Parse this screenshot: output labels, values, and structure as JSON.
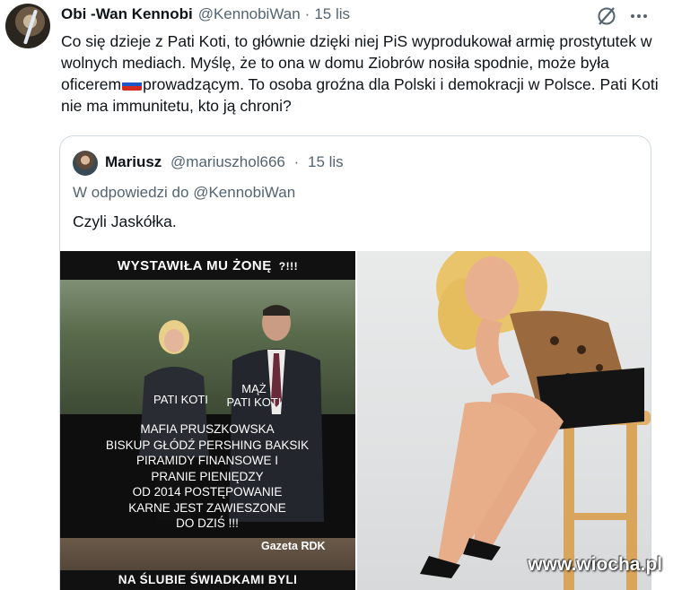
{
  "tweet": {
    "author_name": "Obi -Wan Kennobi",
    "author_handle": "@KennobiWan",
    "separator": "·",
    "time": "15 lis",
    "text_part1": "Co się dzieje z Pati Koti, to głównie dzięki niej PiS wyprodukował armię prostytutek w wolnych mediach. Myślę, że to ona w domu Ziobrów nosiła spodnie, może była oficerem",
    "text_part2": "prowadzącym. To osoba groźna dla Polski i demokracji w Polsce. Pati Koti nie ma immunitetu, kto ją chroni?",
    "flag_icon": "russia-flag-icon",
    "grok_icon": "grok-icon",
    "more_icon": "more-icon"
  },
  "quote": {
    "author_name": "Mariusz",
    "author_handle": "@mariuszhol666",
    "separator": "·",
    "time": "15 lis",
    "reply_prefix": "W odpowiedzi do",
    "reply_mention": "@KennobiWan",
    "text": "Czyli Jaskółka."
  },
  "meme": {
    "caption_top": "WYSTAWIŁA MU ŻONĘ",
    "caption_top_suffix": "?!!!",
    "label_woman": "PATI KOTI",
    "label_man_line1": "MĄŻ",
    "label_man_line2": "PATI KOTI",
    "box_lines": [
      "MAFIA PRUSZKOWSKA",
      "BISKUP GŁÓDŹ PERSHING BAKSIK",
      "PIRAMIDY FINANSOWE I",
      "PRANIE PIENIĘDZY",
      "OD 2014 POSTĘPOWANIE",
      "KARNE JEST ZAWIESZONE",
      "DO DZIŚ !!!"
    ],
    "source": "Gazeta RDK",
    "caption_bottom": "NA ŚLUBIE ŚWIADKAMI BYLI"
  },
  "watermark": "www.wiocha.pl",
  "colors": {
    "text_primary": "#0f1419",
    "text_secondary": "#536471",
    "border": "#cfd9de"
  }
}
